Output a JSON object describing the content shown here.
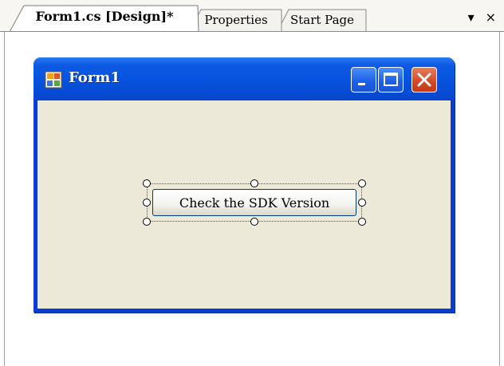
{
  "tabs": [
    {
      "label": "Form1.cs [Design]*",
      "active": true
    },
    {
      "label": "Properties",
      "active": false
    },
    {
      "label": "Start Page",
      "active": false
    }
  ],
  "tab_controls": {
    "dropdown_glyph": "▾",
    "close_glyph": "×"
  },
  "form": {
    "title": "Form1",
    "icon": "form-app-icon",
    "buttons": {
      "minimize": "minimize-icon",
      "maximize": "maximize-icon",
      "close": "close-icon"
    }
  },
  "design_button": {
    "label": "Check the SDK Version",
    "selected": true
  },
  "colors": {
    "titlebar": "#0652dd",
    "client_background": "#ece9d8",
    "close_button": "#d44824"
  }
}
